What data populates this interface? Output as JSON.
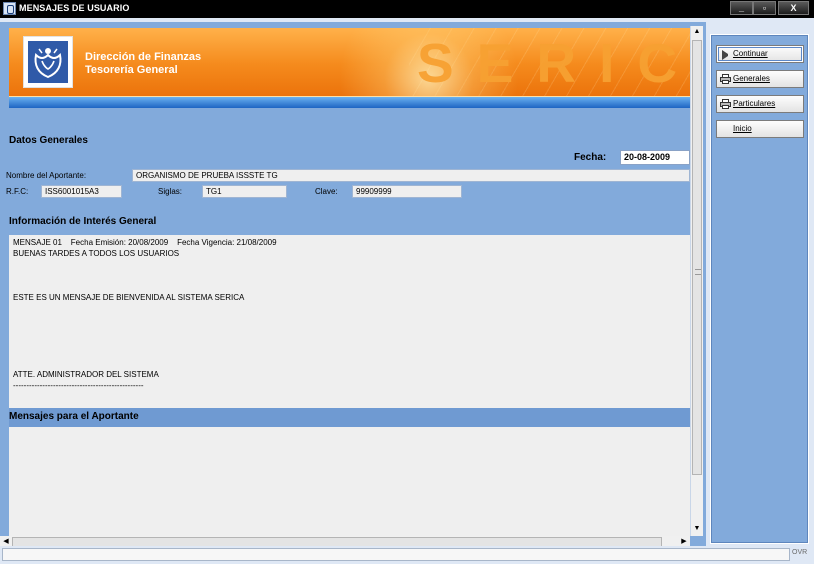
{
  "window": {
    "title": "MENSAJES DE USUARIO",
    "controls": {
      "minimize": "_",
      "restore": "▫",
      "close": "X"
    }
  },
  "banner": {
    "line1": "Dirección de Finanzas",
    "line2": "Tesorería General",
    "watermark": "SERICA"
  },
  "datos_generales": {
    "heading": "Datos Generales",
    "fecha_label": "Fecha:",
    "fecha_value": "20-08-2009",
    "aportante_label": "Nombre del Aportante:",
    "aportante_value": "ORGANISMO DE PRUEBA ISSSTE TG",
    "rfc_label": "R.F.C:",
    "rfc_value": "ISS6001015A3",
    "siglas_label": "Siglas:",
    "siglas_value": "TG1",
    "clave_label": "Clave:",
    "clave_value": "99909999"
  },
  "informacion": {
    "heading": "Información de Interés General",
    "lines": [
      "MENSAJE 01    Fecha Emisión: 20/08/2009    Fecha Vigencia: 21/08/2009",
      "BUENAS TARDES A TODOS LOS USUARIOS",
      "",
      "",
      "",
      "ESTE ES UN MENSAJE DE BIENVENIDA AL SISTEMA SERICA",
      "",
      "",
      "",
      "",
      "",
      "",
      "ATTE. ADMINISTRADOR DEL SISTEMA",
      "-------------------------------------------------"
    ]
  },
  "mensajes_aportante": {
    "heading": "Mensajes para el Aportante"
  },
  "sidebar": {
    "buttons": [
      {
        "label": "Continuar",
        "icon": "play-icon"
      },
      {
        "label": "Generales",
        "icon": "printer-icon"
      },
      {
        "label": "Particulares",
        "icon": "printer-icon"
      },
      {
        "label": "Inicio",
        "icon": ""
      }
    ]
  },
  "statusbar": {
    "mode": "OVR"
  },
  "colors": {
    "panel": "#82aadb",
    "banner_orange": "#f58b1d",
    "banner_blue": "#1d64c3"
  }
}
